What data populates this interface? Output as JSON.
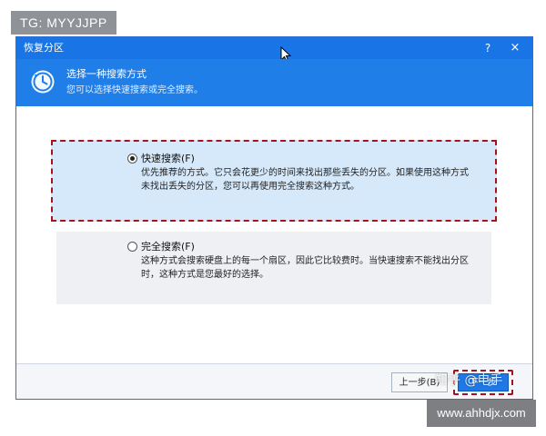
{
  "overlay": {
    "tag": "TG: MYYJJPP",
    "site": "www.ahhdjx.com",
    "zhihu_watermark": "知乎 @电手"
  },
  "window": {
    "title": "恢复分区",
    "help": "?",
    "close": "×"
  },
  "header": {
    "title": "选择一种搜索方式",
    "subtitle": "您可以选择快速搜索或完全搜索。"
  },
  "options": [
    {
      "label": "快速搜索(F)",
      "selected": true,
      "desc_line1": "优先推荐的方式。它只会花更少的时间来找出那些丢失的分区。如果使用这种方式",
      "desc_line2": "未找出丢失的分区，您可以再使用完全搜索这种方式。"
    },
    {
      "label": "完全搜索(F)",
      "selected": false,
      "desc_line1": "这种方式会搜索硬盘上的每一个扇区，因此它比较费时。当快速搜索不能找出分区",
      "desc_line2": "时，这种方式是您最好的选择。"
    }
  ],
  "footer": {
    "back": "上一步(B)",
    "next": "下一步"
  },
  "colors": {
    "title_bar": "#1975e6",
    "header_bg": "#1f7ee8",
    "selected_option_bg": "#d6e9fb",
    "highlight_dash": "#a5141c"
  }
}
